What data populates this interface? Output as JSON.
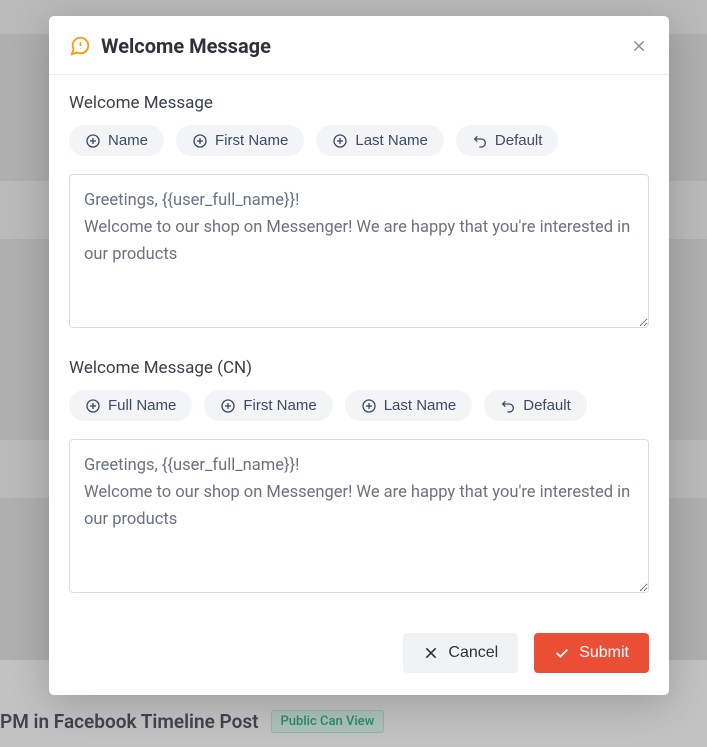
{
  "modal": {
    "title": "Welcome Message",
    "section1": {
      "label": "Welcome Message",
      "chips": {
        "name": "Name",
        "first": "First Name",
        "last": "Last Name",
        "default": "Default"
      },
      "text": "Greetings, {{user_full_name}}!\nWelcome to our shop on Messenger! We are happy that you're interested in our products"
    },
    "section2": {
      "label": "Welcome Message (CN)",
      "chips": {
        "full": "Full Name",
        "first": "First Name",
        "last": "Last Name",
        "default": "Default"
      },
      "text": "Greetings, {{user_full_name}}!\nWelcome to our shop on Messenger! We are happy that you're interested in our products"
    },
    "footer": {
      "cancel": "Cancel",
      "submit": "Submit"
    }
  },
  "background": {
    "line": "PM in Facebook Timeline Post",
    "badge": "Public Can View"
  }
}
